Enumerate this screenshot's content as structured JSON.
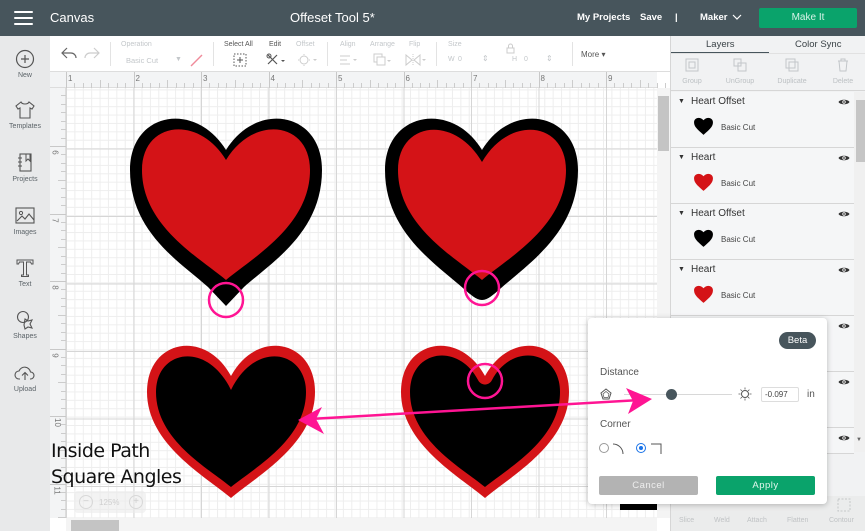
{
  "topbar": {
    "menu_icon": "hamburger-icon",
    "app_title": "Canvas",
    "document_title": "Offeset Tool 5*",
    "my_projects": "My Projects",
    "save": "Save",
    "separator": "|",
    "machine": "Maker",
    "machine_chevron": "chevron-down-icon",
    "make_it": "Make It"
  },
  "toolbar": {
    "undo_icon": "undo-icon",
    "redo_icon": "redo-icon",
    "operation_label": "Operation",
    "operation_value": "Basic Cut",
    "select_all_label": "Select All",
    "edit_label": "Edit",
    "offset_label": "Offset",
    "align_label": "Align",
    "arrange_label": "Arrange",
    "flip_label": "Flip",
    "size_label": "Size",
    "width_label": "W",
    "width_value": "0",
    "height_label": "H",
    "height_value": "0",
    "more_label": "More ▾"
  },
  "sidebar": {
    "items": [
      {
        "label": "New",
        "icon": "plus-circle-icon"
      },
      {
        "label": "Templates",
        "icon": "shirt-icon"
      },
      {
        "label": "Projects",
        "icon": "notebook-icon"
      },
      {
        "label": "Images",
        "icon": "image-icon"
      },
      {
        "label": "Text",
        "icon": "text-icon"
      },
      {
        "label": "Shapes",
        "icon": "shapes-icon"
      },
      {
        "label": "Upload",
        "icon": "cloud-upload-icon"
      }
    ]
  },
  "ruler": {
    "top": [
      "1",
      "2",
      "3",
      "4",
      "5",
      "6",
      "7",
      "8",
      "9"
    ],
    "left": [
      "6",
      "7",
      "8",
      "9",
      "10",
      "11"
    ]
  },
  "canvas": {
    "zoom_level": "125%",
    "zoom_out": "−",
    "zoom_in": "+",
    "colors": {
      "red": "#d41317",
      "black": "#000000",
      "annotation": "#ff1493"
    },
    "annotation_text": [
      "Inside Path",
      "Square Angles"
    ]
  },
  "layers_panel": {
    "tabs": [
      "Layers",
      "Color Sync"
    ],
    "active_tab": "Layers",
    "actions": [
      "Group",
      "UnGroup",
      "Duplicate",
      "Delete"
    ],
    "layers": [
      {
        "name": "Heart Offset",
        "operation": "Basic Cut",
        "color": "#000000"
      },
      {
        "name": "Heart",
        "operation": "Basic Cut",
        "color": "#d41317"
      },
      {
        "name": "Heart Offset",
        "operation": "Basic Cut",
        "color": "#000000"
      },
      {
        "name": "Heart",
        "operation": "Basic Cut",
        "color": "#d41317"
      }
    ],
    "bottom_tools": [
      "Slice",
      "Weld",
      "Attach",
      "Flatten",
      "Contour"
    ]
  },
  "offset_dialog": {
    "badge": "Beta",
    "distance_label": "Distance",
    "distance_value": "-0.097",
    "distance_unit": "in",
    "corner_label": "Corner",
    "corner_options": [
      "Rounded",
      "Square"
    ],
    "corner_selected": "Square",
    "cancel_label": "Cancel",
    "apply_label": "Apply"
  }
}
